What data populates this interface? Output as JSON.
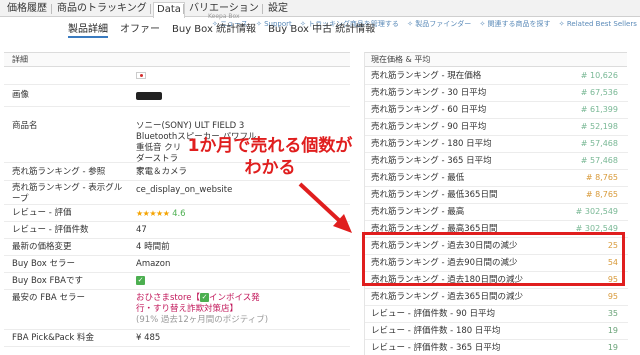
{
  "top_tabs": [
    "価格履歴",
    "商品のトラッキング",
    "Data",
    "バリエーション",
    "設定"
  ],
  "keepa_label": "Keepa Box",
  "top_links": [
    "✧ ニュース",
    "✧ Support",
    "✧ トラッキング商品を管理する",
    "✧ 製品ファインダー",
    "✧ 関連する商品を探す",
    "✧ Related Best Sellers"
  ],
  "sub_tabs": [
    "製品詳細",
    "オファー",
    "Buy Box 統計情報",
    "Buy Box 中古 統計情報"
  ],
  "left_panel": {
    "title": "詳細",
    "rows": {
      "image_label": "画像",
      "product_name_label": "商品名",
      "product_name_value": "ソニー(SONY) ULT FIELD 3 Bluetoothスピーカー パワフル重低音 クリ　　　　　　　　　　　　ダーストラ　　　　　　　　　　　　ー",
      "rank_ref_label": "売れ筋ランキング - 参照",
      "rank_ref_value": "家電＆カメラ",
      "rank_group_label": "売れ筋ランキング - 表示グループ",
      "rank_group_value": "ce_display_on_website",
      "review_rating_label": "レビュー - 評価",
      "review_rating_stars": "★★★★★",
      "review_rating_value": "4.6",
      "review_count_label": "レビュー - 評価件数",
      "review_count_value": "47",
      "latest_price_label": "最新の価格変更",
      "latest_price_value": "4 時間前",
      "buybox_seller_label": "Buy Box セラー",
      "buybox_seller_value": "Amazon",
      "buybox_fba_label": "Buy Box FBAです",
      "fba_seller_label": "最安の FBA セラー",
      "fba_seller_value": "おひさまstore【",
      "fba_seller_value_rest": "インボイス発行・すり替え詐欺対策店】",
      "fba_seller_note": "(91% 過去12ヶ月間のポジティブ)",
      "pickpack_label": "FBA Pick&Pack 料金",
      "pickpack_value": "¥ 485"
    }
  },
  "right_panel": {
    "title": "現在価格 & 平均",
    "rows": [
      {
        "label": "売れ筋ランキング - 現在価格",
        "value": "# 10,626"
      },
      {
        "label": "売れ筋ランキング - 30 日平均",
        "value": "# 67,536"
      },
      {
        "label": "売れ筋ランキング - 60 日平均",
        "value": "# 61,399"
      },
      {
        "label": "売れ筋ランキング - 90 日平均",
        "value": "# 52,198"
      },
      {
        "label": "売れ筋ランキング - 180 日平均",
        "value": "# 57,468"
      },
      {
        "label": "売れ筋ランキング - 365 日平均",
        "value": "# 57,468"
      },
      {
        "label": "売れ筋ランキング - 最低",
        "value": "# 8,765"
      },
      {
        "label": "売れ筋ランキング - 最低365日間",
        "value": "# 8,765"
      },
      {
        "label": "売れ筋ランキング - 最高",
        "value": "# 302,549"
      },
      {
        "label": "売れ筋ランキング - 最高365日間",
        "value": "# 302,549"
      },
      {
        "label": "売れ筋ランキング - 過去30日間の減少",
        "value": "25"
      },
      {
        "label": "売れ筋ランキング - 過去90日間の減少",
        "value": "54"
      },
      {
        "label": "売れ筋ランキング - 過去180日間の減少",
        "value": "95"
      },
      {
        "label": "売れ筋ランキング - 過去365日間の減少",
        "value": "95"
      },
      {
        "label": "レビュー - 評価件数 - 90 日平均",
        "value": "35"
      },
      {
        "label": "レビュー - 評価件数 - 180 日平均",
        "value": "19"
      },
      {
        "label": "レビュー - 評価件数 - 365 日平均",
        "value": "19"
      }
    ]
  },
  "annotation": {
    "line1": "1か月で売れる個数が",
    "line2": "わかる",
    "color": "#e01e1e"
  }
}
